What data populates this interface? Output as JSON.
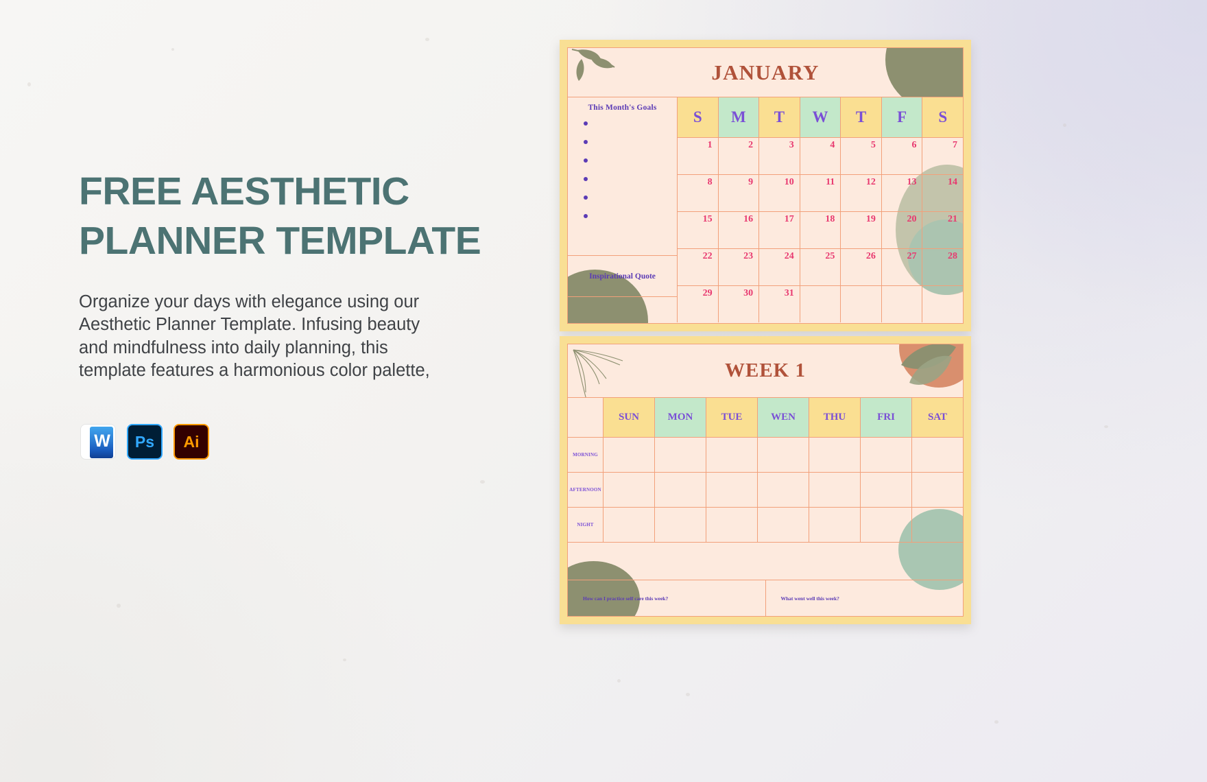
{
  "left": {
    "title_line1": "FREE AESTHETIC",
    "title_line2": "PLANNER TEMPLATE",
    "description": "Organize your days with elegance using our Aesthetic Planner Template. Infusing beauty and mindfulness into daily planning, this template features a harmonious color palette,",
    "title_color": "#4c7373",
    "badges": [
      {
        "name": "word",
        "label": "W"
      },
      {
        "name": "photoshop",
        "label": "Ps"
      },
      {
        "name": "illustrator",
        "label": "Ai"
      }
    ]
  },
  "calendar": {
    "month": "JANUARY",
    "goals_heading": "This Month's Goals",
    "goal_bullets": [
      "",
      "",
      "",
      "",
      "",
      ""
    ],
    "quote_heading": "Inspirational Quote",
    "weekday_initials": [
      "S",
      "M",
      "T",
      "W",
      "T",
      "F",
      "S"
    ],
    "weeks": [
      [
        "1",
        "2",
        "3",
        "4",
        "5",
        "6",
        "7"
      ],
      [
        "8",
        "9",
        "10",
        "11",
        "12",
        "13",
        "14"
      ],
      [
        "15",
        "16",
        "17",
        "18",
        "19",
        "20",
        "21"
      ],
      [
        "22",
        "23",
        "24",
        "25",
        "26",
        "27",
        "28"
      ],
      [
        "29",
        "30",
        "31",
        "",
        "",
        "",
        ""
      ]
    ]
  },
  "week": {
    "title": "WEEK 1",
    "days": [
      "SUN",
      "MON",
      "TUE",
      "WEN",
      "THU",
      "FRI",
      "SAT"
    ],
    "time_rows": [
      "MORNING",
      "AFTERNOON",
      "NIGHT"
    ],
    "footer_prompts": [
      "How can I practice self care this week?",
      "What went well this week?"
    ]
  },
  "colors": {
    "card_frame": "#f9df94",
    "sheet": "#fdeade",
    "border": "#f2a07a",
    "header_yellow": "#fadf92",
    "header_green": "#c3e8ca",
    "title_brown": "#b0523a",
    "label_purple": "#7a4fd6",
    "date_pink": "#e8386f",
    "olive": "#8d9070",
    "sage": "#a9c6b2"
  }
}
